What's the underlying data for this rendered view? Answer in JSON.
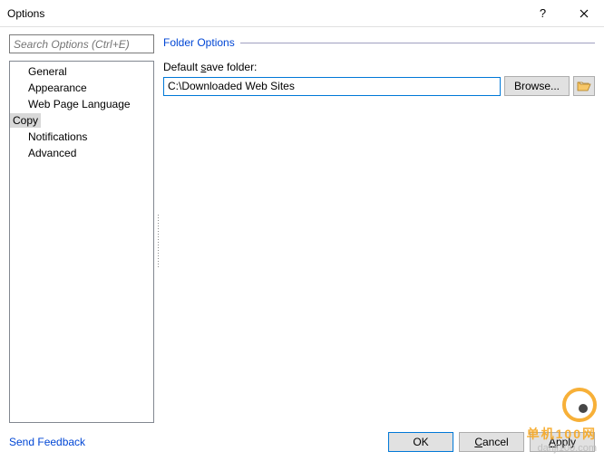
{
  "window": {
    "title": "Options"
  },
  "search": {
    "placeholder": "Search Options (Ctrl+E)"
  },
  "section": {
    "title": "Folder Options"
  },
  "nav": {
    "items": [
      {
        "label": "General",
        "selected": false
      },
      {
        "label": "Appearance",
        "selected": false
      },
      {
        "label": "Web Page Language",
        "selected": false
      },
      {
        "label": "Copy",
        "selected": true
      },
      {
        "label": "Notifications",
        "selected": false
      },
      {
        "label": "Advanced",
        "selected": false
      }
    ]
  },
  "folder": {
    "label_pre": "Default ",
    "label_underline": "s",
    "label_post": "ave folder:",
    "value": "C:\\Downloaded Web Sites",
    "browse": "Browse..."
  },
  "footer": {
    "feedback": "Send Feedback",
    "ok": "OK",
    "cancel_pre": "",
    "cancel_u": "C",
    "cancel_post": "ancel",
    "apply_pre": "",
    "apply_u": "A",
    "apply_post": "pply"
  },
  "watermark": {
    "line1": "单机100网",
    "line2": "danji100.com"
  }
}
